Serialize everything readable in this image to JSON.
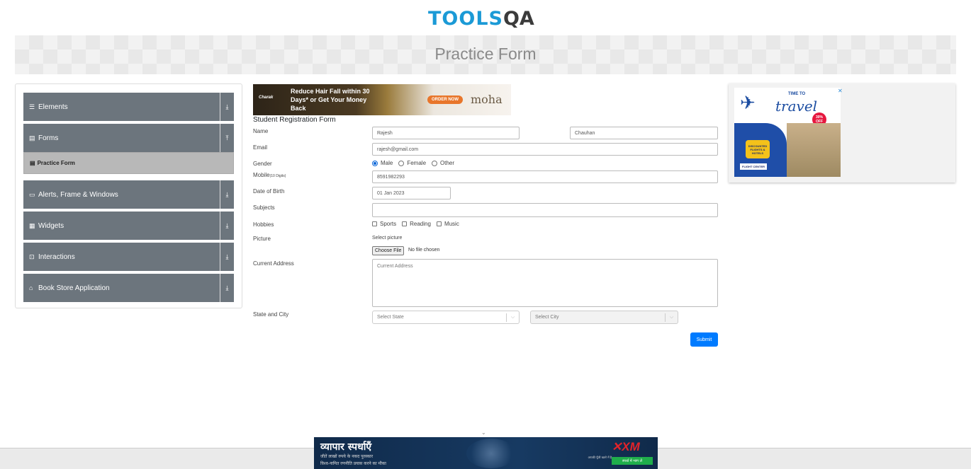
{
  "header": {
    "logo_text": "TOOLS",
    "logo_q": "QA"
  },
  "banner": {
    "title": "Practice Form"
  },
  "sidebar": {
    "groups": [
      {
        "label": "Elements",
        "icon": "menu-icon",
        "arrow": "⤓"
      },
      {
        "label": "Forms",
        "icon": "form-icon",
        "arrow": "⤒"
      },
      {
        "label": "Alerts, Frame & Windows",
        "icon": "window-icon",
        "arrow": "⤓"
      },
      {
        "label": "Widgets",
        "icon": "widgets-icon",
        "arrow": "⤓"
      },
      {
        "label": "Interactions",
        "icon": "interactions-icon",
        "arrow": "⤓"
      },
      {
        "label": "Book Store Application",
        "icon": "bookstore-icon",
        "arrow": "⤓"
      }
    ],
    "active_item": "Practice Form"
  },
  "ad_top": {
    "headline": "Reduce Hair Fall within 30 Days* or Get Your Money Back",
    "button": "ORDER NOW",
    "brand": "moha",
    "maker": "Charak"
  },
  "form": {
    "title": "Student Registration Form",
    "labels": {
      "name": "Name",
      "email": "Email",
      "gender": "Gender",
      "mobile": "Mobile",
      "mobile_hint": "(10 Digits)",
      "dob": "Date of Birth",
      "subjects": "Subjects",
      "hobbies": "Hobbies",
      "picture": "Picture",
      "address": "Current Address",
      "state_city": "State and City"
    },
    "first_name": "Rajesh",
    "last_name": "Chauhan",
    "email": "rajesh@gmail.com",
    "gender_options": [
      "Male",
      "Female",
      "Other"
    ],
    "mobile": "8591982293",
    "dob": "01 Jan 2023",
    "subjects": "",
    "hobby_options": [
      "Sports",
      "Reading",
      "Music"
    ],
    "picture_label": "Select picture",
    "file_button": "Choose File",
    "file_status": "No file chosen",
    "address_placeholder": "Current Address",
    "state_placeholder": "Select State",
    "city_placeholder": "Select City",
    "submit": "Submit"
  },
  "ad_right": {
    "top_text": "TIME TO",
    "main_text": "travel",
    "discount": "30% OFF",
    "tag": "DISCOUNTED FLIGHTS & HOTELS",
    "brand": "FLIGHT CENTER",
    "close": "✕"
  },
  "ad_bottom": {
    "headline": "व्यापार स्पर्धाएँ",
    "line1": "जीतें लाखों रुपये के नकद पुरस्कार",
    "line2": "विश्व-नामित रणनीति प्रयास करने का मौका",
    "brand_x": "🙅",
    "brand": "XM",
    "right_text": "आपकी पूँजी खतरे में है",
    "cta": "स्पर्धा में भाग लें"
  },
  "colors": {
    "accent": "#007bff",
    "sidebar_bg": "#6c757d",
    "logo_blue": "#1b9ad6"
  }
}
